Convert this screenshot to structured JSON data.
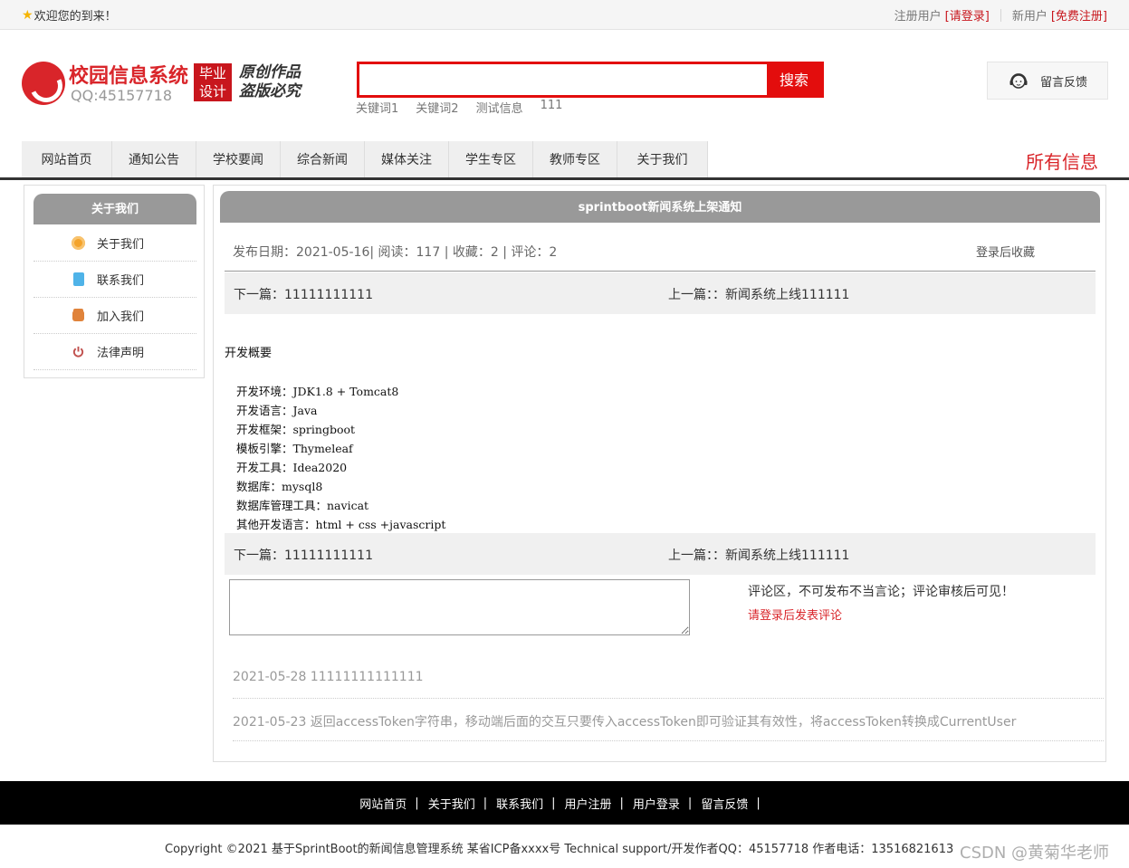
{
  "topbar": {
    "welcome": "欢迎您的到来！",
    "registered_label": "注册用户",
    "login_link": "[请登录]",
    "new_user_label": "新用户",
    "register_link": "[免费注册]"
  },
  "header": {
    "logo_title": "校园信息系统",
    "logo_qq": "QQ:45157718",
    "logo_badge_line1": "毕业",
    "logo_badge_line2": "设计",
    "slogan_line1": "原创作品",
    "slogan_line2": "盗版必究",
    "search": {
      "value": "",
      "placeholder": "",
      "button_label": "搜索"
    },
    "keywords": [
      "关键词1",
      "关键词2",
      "测试信息",
      "111"
    ],
    "feedback_label": "留言反馈"
  },
  "nav": {
    "items": [
      "网站首页",
      "通知公告",
      "学校要闻",
      "综合新闻",
      "媒体关注",
      "学生专区",
      "教师专区",
      "关于我们"
    ],
    "all_info": "所有信息"
  },
  "sidebar": {
    "title": "关于我们",
    "items": [
      {
        "label": "关于我们",
        "icon": "orange-circle-icon"
      },
      {
        "label": "联系我们",
        "icon": "clipboard-icon"
      },
      {
        "label": "加入我们",
        "icon": "lock-icon"
      },
      {
        "label": "法律声明",
        "icon": "power-icon"
      }
    ]
  },
  "article": {
    "title": "sprintboot新闻系统上架通知",
    "meta": "发布日期：2021-05-16|   阅读：117  |   收藏：2  |    评论：2",
    "favorite_link": "登录后收藏",
    "next_label": "下一篇：11111111111",
    "prev_label": "上一篇：：新闻系统上线111111",
    "content_heading": "开发概要",
    "content_lines": [
      "开发环境：JDK1.8 + Tomcat8",
      "开发语言：Java",
      "开发框架：springboot",
      "模板引擎：Thymeleaf",
      "开发工具：Idea2020",
      "数据库：mysql8",
      "数据库管理工具：navicat",
      "其他开发语言：html + css +javascript"
    ]
  },
  "comments": {
    "textarea_value": "",
    "note": "评论区，不可发布不当言论；评论审核后可见！",
    "login_prompt": "请登录后发表评论",
    "items": [
      "2021-05-28 11111111111111",
      "2021-05-23 返回accessToken字符串，移动端后面的交互只要传入accessToken即可验证其有效性，将accessToken转换成CurrentUser"
    ]
  },
  "footer": {
    "links": [
      "网站首页",
      "关于我们",
      "联系我们",
      "用户注册",
      "用户登录",
      "留言反馈"
    ],
    "separator": "|",
    "copyright": "Copyright ©2021 基于SprintBoot的新闻信息管理系统    某省ICP备xxxx号    Technical support/开发作者QQ：45157718     作者电话：13516821613",
    "watermark": "CSDN @黄菊华老师"
  },
  "colors": {
    "brand_red": "#d9252a",
    "search_red": "#e30d0d",
    "panel_gray": "#999999",
    "footer_black": "#000000"
  }
}
